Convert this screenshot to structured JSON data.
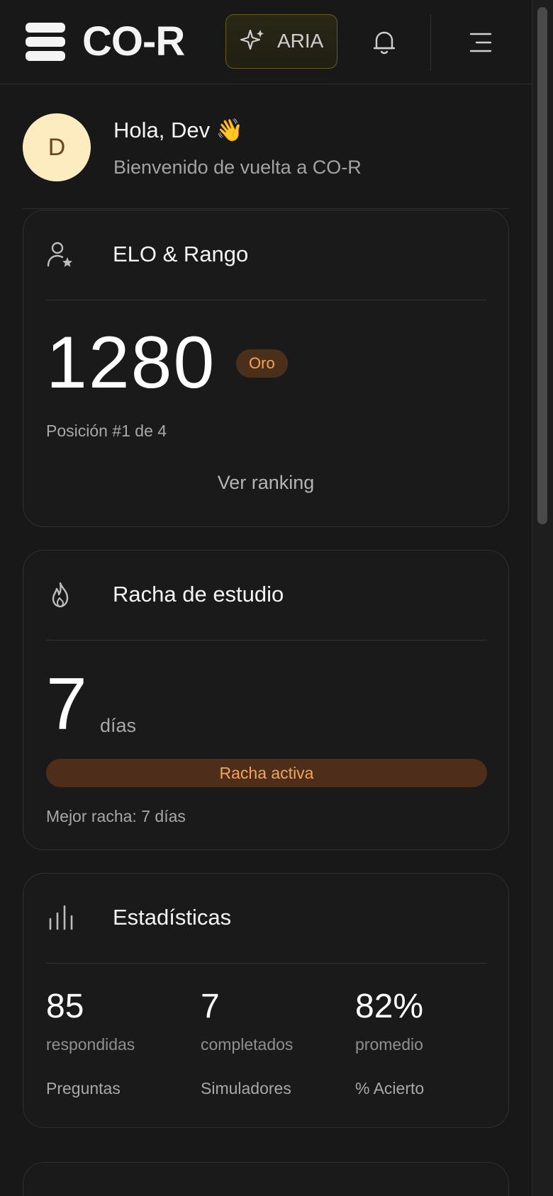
{
  "header": {
    "logo_text": "CO-R",
    "aria_label": "ARIA",
    "icons": {
      "logo": "stacked-layers-icon",
      "aria": "sparkle-icon",
      "notifications": "bell-icon",
      "menu": "menu-icon"
    }
  },
  "greeting": {
    "avatar_initial": "D",
    "title": "Hola, Dev 👋",
    "subtitle": "Bienvenido de vuelta a CO-R"
  },
  "elo_card": {
    "title": "ELO & Rango",
    "icon": "user-star-icon",
    "value": "1280",
    "tier": "Oro",
    "position_text": "Posición #1 de 4",
    "link": "Ver ranking"
  },
  "streak_card": {
    "title": "Racha de estudio",
    "icon": "flame-icon",
    "value": "7",
    "unit": "días",
    "status": "Racha activa",
    "best_text": "Mejor racha: 7 días"
  },
  "stats_card": {
    "title": "Estadísticas",
    "icon": "bar-chart-icon",
    "items": [
      {
        "value": "85",
        "unit": "respondidas",
        "name": "Preguntas"
      },
      {
        "value": "7",
        "unit": "completados",
        "name": "Simuladores"
      },
      {
        "value": "82%",
        "unit": "promedio",
        "name": "% Acierto"
      }
    ]
  },
  "colors": {
    "background": "#181818",
    "accent_orange": "#f3a45b",
    "badge_bg": "#4a2f1b",
    "avatar_bg": "#fdecbf",
    "aria_border": "#6a5a1e"
  }
}
